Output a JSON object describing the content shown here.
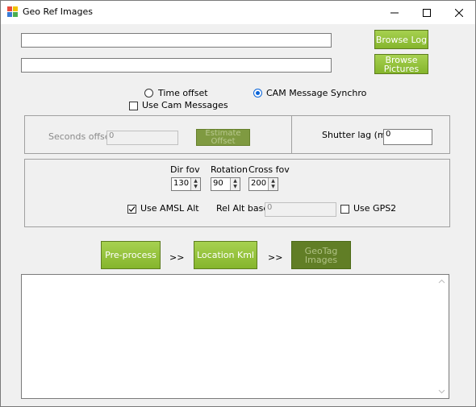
{
  "window": {
    "title": "Geo Ref Images"
  },
  "top": {
    "log_path": "",
    "pictures_path": "",
    "browse_log_label": "Browse Log",
    "browse_pictures_label": "Browse Pictures"
  },
  "mode": {
    "time_offset_label": "Time offset",
    "cam_message_synchro_label": "CAM Message Synchro",
    "selected": "CAM Message Synchro",
    "use_cam_messages_label": "Use Cam Messages",
    "use_cam_messages_checked": false
  },
  "offset": {
    "seconds_offset_label": "Seconds offse",
    "seconds_offset_value": "0",
    "estimate_offset_label": "Estimate Offset",
    "shutter_lag_label": "Shutter lag (ms",
    "shutter_lag_value": "0"
  },
  "params": {
    "dir_fov_label": "Dir fov",
    "dir_fov_value": "130",
    "rotation_label": "Rotation",
    "rotation_value": "90",
    "cross_fov_label": "Cross fov",
    "cross_fov_value": "200",
    "use_amsl_alt_label": "Use AMSL Alt",
    "use_amsl_alt_checked": true,
    "rel_alt_base_label": "Rel Alt base",
    "rel_alt_base_value": "0",
    "use_gps2_label": "Use GPS2",
    "use_gps2_checked": false
  },
  "actions": {
    "preprocess_label": "Pre-process",
    "sep1": ">>",
    "location_kml_label": "Location Kml",
    "sep2": ">>",
    "geotag_label": "GeoTag Images"
  },
  "colors": {
    "accent_green": "#8fbf35",
    "radio_blue": "#0a64d8"
  }
}
